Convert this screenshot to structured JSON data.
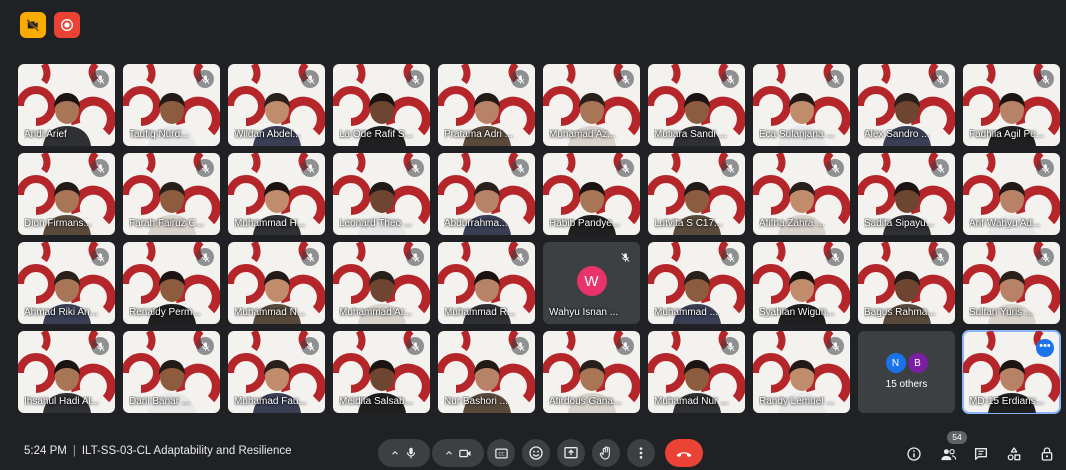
{
  "top_icons": [
    "camera-off-icon",
    "record-icon"
  ],
  "colors": {
    "brand_red": "#b5262b",
    "end_call": "#ea4335",
    "selected_outline": "#8ab4f8",
    "avatar_w": "#e8336b"
  },
  "participants": [
    {
      "name": "Andi Arief"
    },
    {
      "name": "Taufiq Nurd..."
    },
    {
      "name": "Wildan Abdel..."
    },
    {
      "name": "La Ode Rafif S..."
    },
    {
      "name": "Pratama Adri ..."
    },
    {
      "name": "Muhamad Az..."
    },
    {
      "name": "Mutiara Sandi ..."
    },
    {
      "name": "Eca Sulanjana ..."
    },
    {
      "name": "Alex Sandro ..."
    },
    {
      "name": "Fadhila Agil Pe..."
    },
    {
      "name": "Dion Firmans..."
    },
    {
      "name": "Farah Fairuz C..."
    },
    {
      "name": "Muhammad H..."
    },
    {
      "name": "Leonard Theo ..."
    },
    {
      "name": "Abdurrahma..."
    },
    {
      "name": "Habib Pandye..."
    },
    {
      "name": "Lutvita S C17..."
    },
    {
      "name": "Afifha Zahra ..."
    },
    {
      "name": "Sadita Sipayu..."
    },
    {
      "name": "Arif Wahyu Ad..."
    },
    {
      "name": "Ahmad Riki An..."
    },
    {
      "name": "Renaldy Perm..."
    },
    {
      "name": "Muhammad N..."
    },
    {
      "name": "Muhammad Ar..."
    },
    {
      "name": "Muhammad R..."
    },
    {
      "name": "Wahyu Isnan ...",
      "initial": "W"
    },
    {
      "name": "Muhammad ..."
    },
    {
      "name": "Syahlan Wigun..."
    },
    {
      "name": "Bagus Rahma..."
    },
    {
      "name": "Sultan Yuris ..."
    },
    {
      "name": "Ihsanul Hadi Al..."
    },
    {
      "name": "Dani Banar ..."
    },
    {
      "name": "Muhamad Fau..."
    },
    {
      "name": "Meidita Salsab..."
    },
    {
      "name": "Nur Bashori ..."
    },
    {
      "name": "Afirdous Gana..."
    },
    {
      "name": "Muhamad Nur ..."
    },
    {
      "name": "Randy Lemuel ..."
    },
    {
      "name": "MD-15 Erdians..."
    }
  ],
  "others": {
    "label": "15 others",
    "avatars": [
      "N",
      "B"
    ],
    "avatar_colors": [
      "#1a73e8",
      "#7b1fa2"
    ]
  },
  "meeting": {
    "time": "5:24 PM",
    "title": "ILT-SS-03-CL Adaptability and Resilience"
  },
  "controls": [
    "mic-icon",
    "camera-icon",
    "captions-icon",
    "emoji-icon",
    "present-icon",
    "raise-hand-icon",
    "more-options-icon",
    "end-call-icon"
  ],
  "right_controls": [
    "info-icon",
    "people-icon",
    "chat-icon",
    "activities-icon",
    "host-controls-icon"
  ],
  "people_count": "54",
  "more_label": "•••"
}
